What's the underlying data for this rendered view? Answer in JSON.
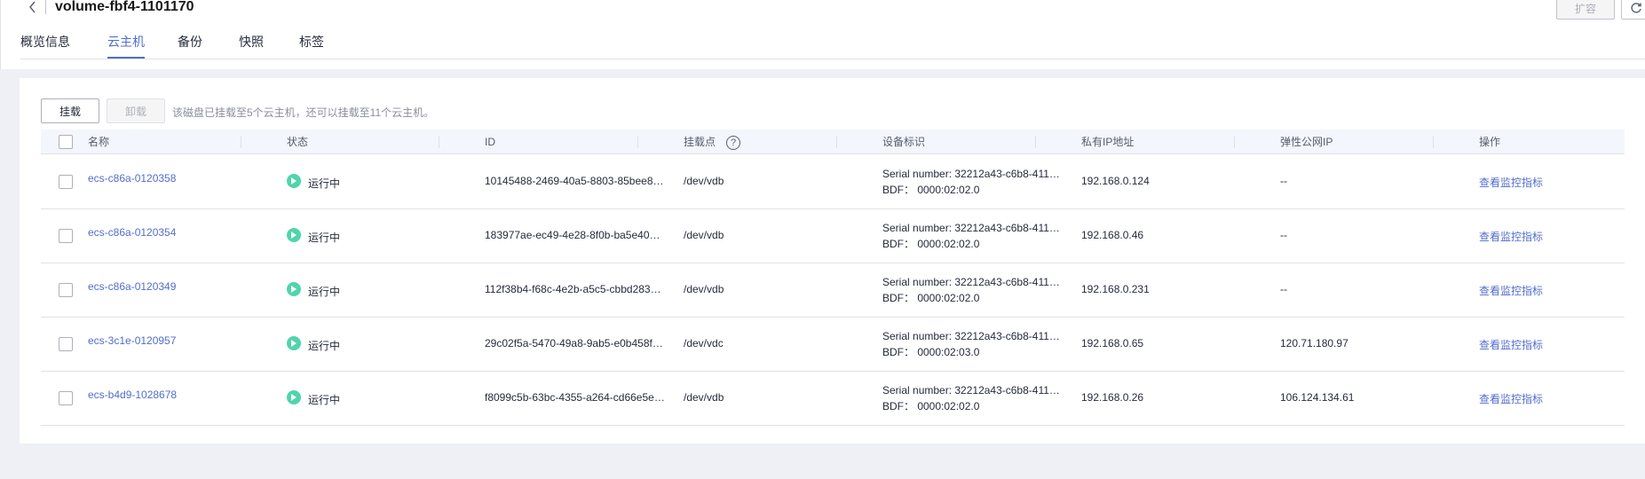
{
  "header": {
    "title": "volume-fbf4-1101170",
    "expand_label": "扩容",
    "tabs": [
      {
        "label": "概览信息"
      },
      {
        "label": "云主机"
      },
      {
        "label": "备份"
      },
      {
        "label": "快照"
      },
      {
        "label": "标签"
      }
    ],
    "active_tab": "云主机"
  },
  "toolbar": {
    "attach_label": "挂载",
    "detach_label": "卸载",
    "hint": "该磁盘已挂载至5个云主机，还可以挂载至11个云主机。"
  },
  "table": {
    "columns": [
      "名称",
      "状态",
      "ID",
      "挂载点",
      "设备标识",
      "私有IP地址",
      "弹性公网IP",
      "操作"
    ],
    "rows": [
      {
        "name": "ecs-c86a-0120358",
        "status": "运行中",
        "id": "10145488-2469-40a5-8803-85bee8…",
        "mount": "/dev/vdb",
        "serial": "Serial number: 32212a43-c6b8-411…",
        "bdf": "BDF：  0000:02:02.0",
        "private_ip": "192.168.0.124",
        "eip": "--",
        "action": "查看监控指标"
      },
      {
        "name": "ecs-c86a-0120354",
        "status": "运行中",
        "id": "183977ae-ec49-4e28-8f0b-ba5e40…",
        "mount": "/dev/vdb",
        "serial": "Serial number: 32212a43-c6b8-411…",
        "bdf": "BDF：  0000:02:02.0",
        "private_ip": "192.168.0.46",
        "eip": "--",
        "action": "查看监控指标"
      },
      {
        "name": "ecs-c86a-0120349",
        "status": "运行中",
        "id": "112f38b4-f68c-4e2b-a5c5-cbbd283…",
        "mount": "/dev/vdb",
        "serial": "Serial number: 32212a43-c6b8-411…",
        "bdf": "BDF：  0000:02:02.0",
        "private_ip": "192.168.0.231",
        "eip": "--",
        "action": "查看监控指标"
      },
      {
        "name": "ecs-3c1e-0120957",
        "status": "运行中",
        "id": "29c02f5a-5470-49a8-9ab5-e0b458f…",
        "mount": "/dev/vdc",
        "serial": "Serial number: 32212a43-c6b8-411…",
        "bdf": "BDF：  0000:02:03.0",
        "private_ip": "192.168.0.65",
        "eip": "120.71.180.97",
        "action": "查看监控指标"
      },
      {
        "name": "ecs-b4d9-1028678",
        "status": "运行中",
        "id": "f8099c5b-63bc-4355-a264-cd66e5e…",
        "mount": "/dev/vdb",
        "serial": "Serial number: 32212a43-c6b8-411…",
        "bdf": "BDF：  0000:02:02.0",
        "private_ip": "192.168.0.26",
        "eip": "106.124.134.61",
        "action": "查看监控指标"
      }
    ]
  }
}
